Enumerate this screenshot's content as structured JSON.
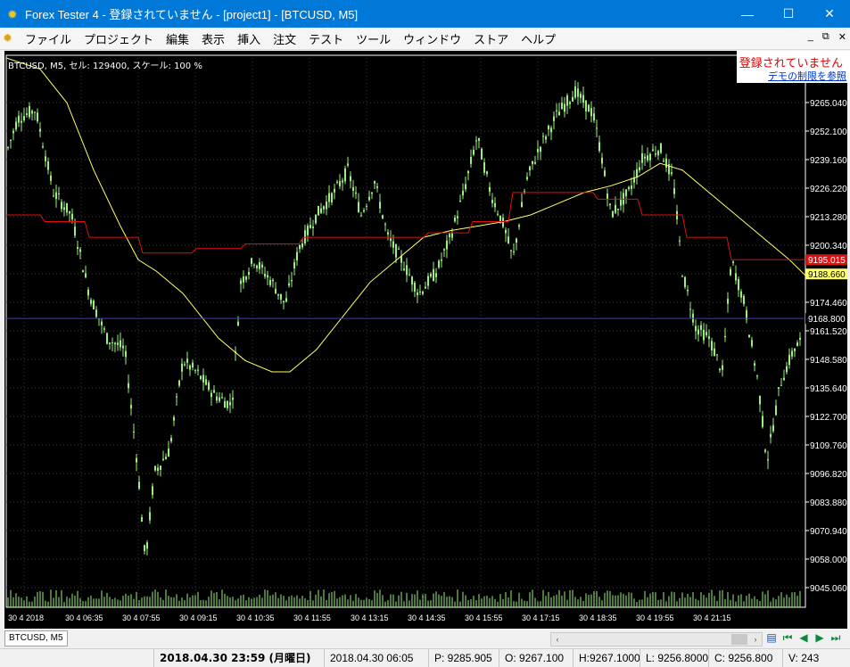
{
  "window": {
    "title": "Forex Tester 4 - 登録されていません - [project1] - [BTCUSD, M5]",
    "controls": [
      "minimize",
      "maximize",
      "close"
    ]
  },
  "menu": [
    "ファイル",
    "プロジェクト",
    "編集",
    "表示",
    "挿入",
    "注文",
    "テスト",
    "ツール",
    "ウィンドウ",
    "ストア",
    "ヘルプ"
  ],
  "chart": {
    "caption": "BTCUSD,  M5,  セル: 129400,  スケール: 100 %",
    "price_labels": [
      "9265.040",
      "9252.100",
      "9239.160",
      "9226.220",
      "9213.280",
      "9200.340",
      "9187.400",
      "9174.460",
      "9161.520",
      "9148.580",
      "9135.640",
      "9122.700",
      "9109.760",
      "9096.820",
      "9083.880",
      "9070.940",
      "9058.000",
      "9045.060"
    ],
    "time_labels": [
      "30 4 2018",
      "30 4 06:35",
      "30 4 07:55",
      "30 4 09:15",
      "30 4 10:35",
      "30 4 11:55",
      "30 4 13:15",
      "30 4 14:35",
      "30 4 15:55",
      "30 4 17:15",
      "30 4 18:35",
      "30 4 19:55",
      "30 4 21:15"
    ],
    "badges": {
      "red": "9195.015",
      "yellow": "9188.660",
      "blue": "9168.800"
    },
    "colors": {
      "background": "#000000",
      "candles": "#9cf07a",
      "ma_yellow": "#ffff66",
      "ma_red": "#e01010",
      "hline_blue": "#3a3ad0",
      "grid": "#3a3a3a"
    },
    "price_range": [
      9040,
      9285
    ]
  },
  "registration": {
    "status": "登録されていません",
    "link": "デモの制限を参照"
  },
  "tabs": [
    "BTCUSD, M5"
  ],
  "statusbar": {
    "current_time": "2018.04.30 23:59 (月曜日)",
    "bar_time": "2018.04.30 06:05",
    "p": "P: 9285.905",
    "o": "O: 9267.100",
    "h": "H:9267.1000",
    "l": "L: 9256.8000",
    "c": "C: 9256.800",
    "v": "V: 243"
  }
}
